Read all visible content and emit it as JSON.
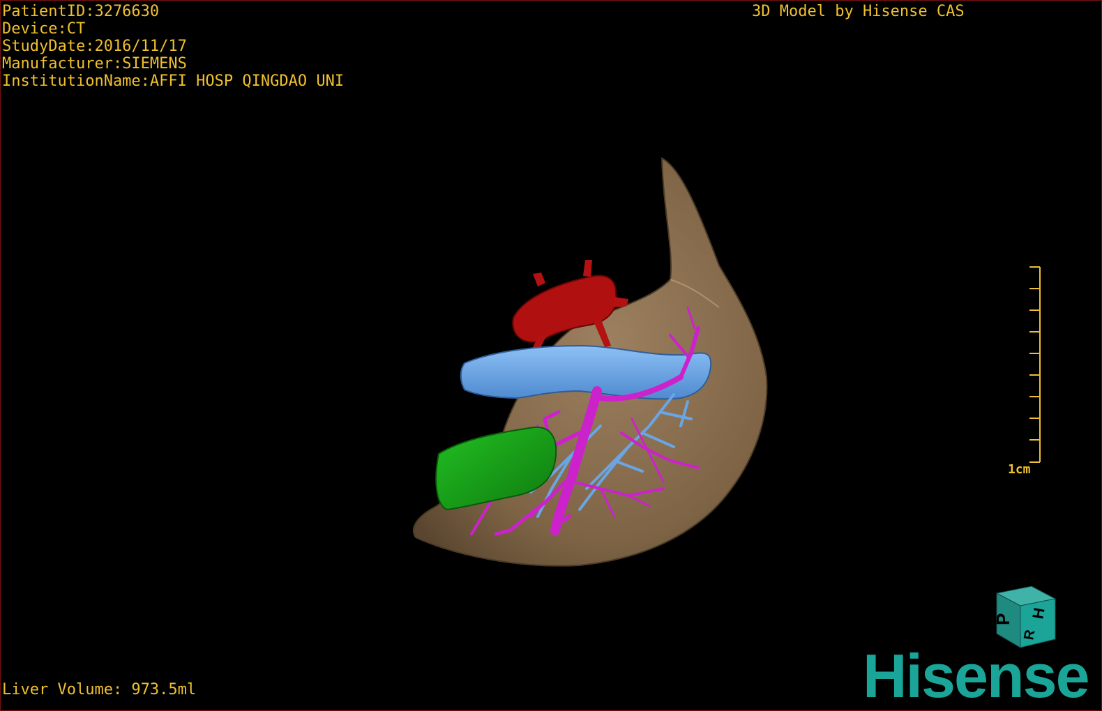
{
  "overlay": {
    "patient_id": "PatientID:3276630",
    "device": "Device:CT",
    "study_date": "StudyDate:2016/11/17",
    "manufacturer": "Manufacturer:SIEMENS",
    "institution": "InstitutionName:AFFI HOSP QINGDAO UNI",
    "credit": "3D Model by Hisense CAS",
    "liver_volume": "Liver Volume: 973.5ml"
  },
  "scale_bar": {
    "label": "1cm"
  },
  "orientation_cube": {
    "faces": [
      "P",
      "H",
      "R"
    ]
  },
  "brand": {
    "name": "Hisense"
  },
  "colors": {
    "overlay_text": "#f0c030",
    "liver": "#8c7150",
    "artery": "#b01010",
    "portal_vein": "#6aa5e6",
    "hepatic_vein": "#cc22cc",
    "gallbladder": "#1aa61a",
    "brand": "#1aa598",
    "border": "#7a1010"
  }
}
